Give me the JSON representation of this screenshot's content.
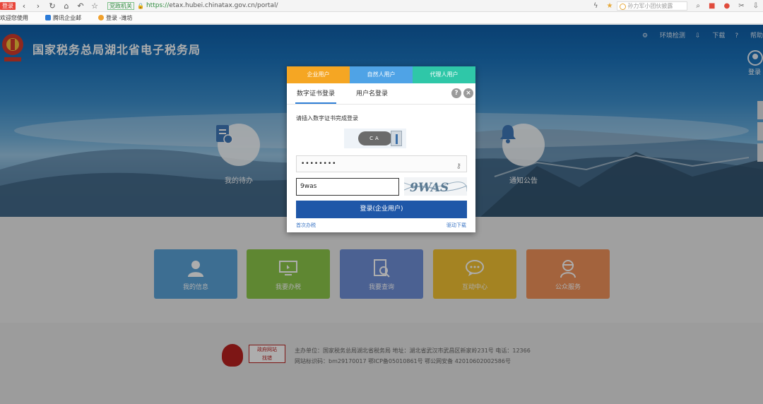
{
  "browser": {
    "badge": "登录",
    "gov_badge": "党政机关",
    "url_https": "https://",
    "url_rest": "etax.hubei.chinatax.gov.cn/portal/",
    "search_text": "孙力军小团伙披露"
  },
  "bookmarks": [
    "欢迎您使用",
    "腾讯企业邮",
    "登录 -潍坊"
  ],
  "header": {
    "site_title": "国家税务总局湖北省电子税务局",
    "links": [
      "环境检测",
      "下载",
      "帮助"
    ],
    "user_label": "登录"
  },
  "features": {
    "left_label": "我的待办",
    "right_label": "通知公告"
  },
  "tiles": [
    {
      "label": "我的信息",
      "color": "#5aa3d8"
    },
    {
      "label": "我要办税",
      "color": "#8cc84b"
    },
    {
      "label": "我要查询",
      "color": "#6f8fd8"
    },
    {
      "label": "互动中心",
      "color": "#f2c233"
    },
    {
      "label": "公众服务",
      "color": "#f0935a"
    }
  ],
  "footer": {
    "logo_text_line1": "政府网站",
    "logo_text_line2": "找错",
    "line1": "主办单位：国家税务总局湖北省税务局   地址：湖北省武汉市武昌区新家岭231号   电话：12366",
    "line2": "网站标识码：bm29170017   鄂ICP备05010861号   鄂公网安备 42010602002586号"
  },
  "modal": {
    "user_tabs": [
      {
        "label": "企业用户",
        "color": "#f5a623"
      },
      {
        "label": "自然人用户",
        "color": "#4fa3e6"
      },
      {
        "label": "代理人用户",
        "color": "#2fc7a8"
      }
    ],
    "login_tabs": [
      "数字证书登录",
      "用户名登录"
    ],
    "help_icon": "?",
    "close_icon": "×",
    "hint": "请插入数字证书完成登录",
    "ca_text": "CA",
    "password_value": "••••••••",
    "captcha_value": "9was",
    "captcha_image_text": "9WAS",
    "login_button": "登录(企业用户)",
    "first_time_link": "首次办税",
    "driver_link": "驱动下载"
  }
}
